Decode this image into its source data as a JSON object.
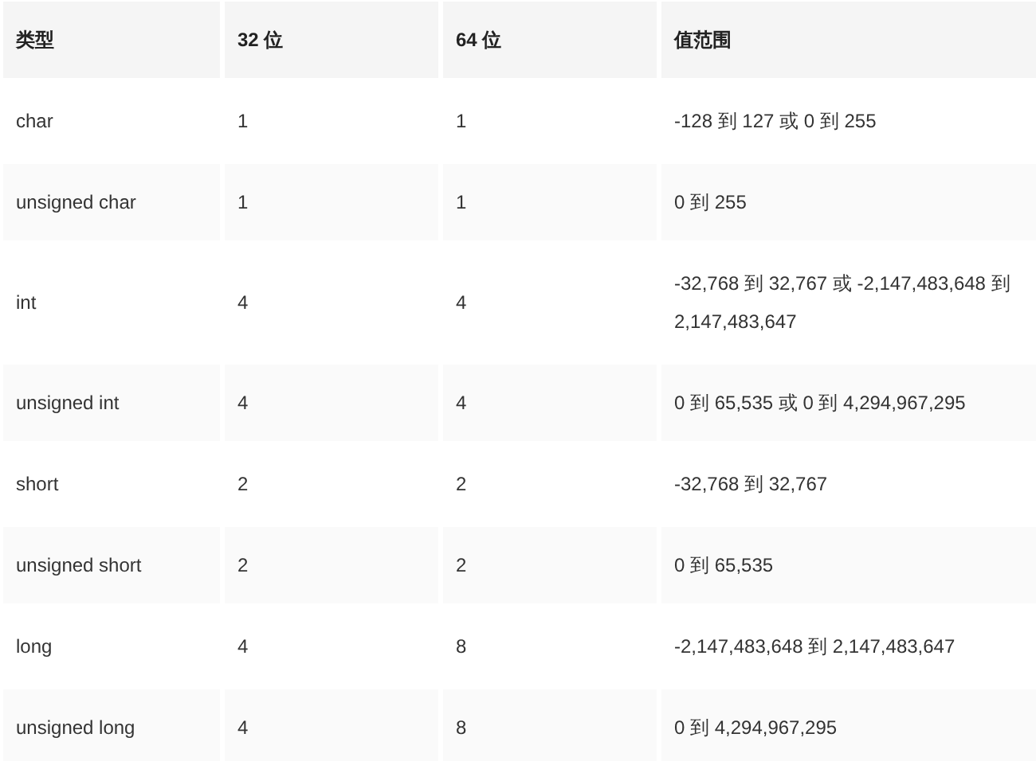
{
  "table": {
    "columns": [
      "类型",
      "32 位",
      "64 位",
      "值范围"
    ],
    "rows": [
      [
        "char",
        "1",
        "1",
        "-128 到 127 或 0 到 255"
      ],
      [
        "unsigned char",
        "1",
        "1",
        "0 到 255"
      ],
      [
        "int",
        "4",
        "4",
        "-32,768 到 32,767 或 -2,147,483,648 到 2,147,483,647"
      ],
      [
        "unsigned int",
        "4",
        "4",
        "0 到 65,535 或 0 到 4,294,967,295"
      ],
      [
        "short",
        "2",
        "2",
        "-32,768 到 32,767"
      ],
      [
        "unsigned short",
        "2",
        "2",
        "0 到 65,535"
      ],
      [
        "long",
        "4",
        "8",
        "-2,147,483,648 到 2,147,483,647"
      ],
      [
        "unsigned long",
        "4",
        "8",
        "0 到 4,294,967,295"
      ]
    ]
  }
}
